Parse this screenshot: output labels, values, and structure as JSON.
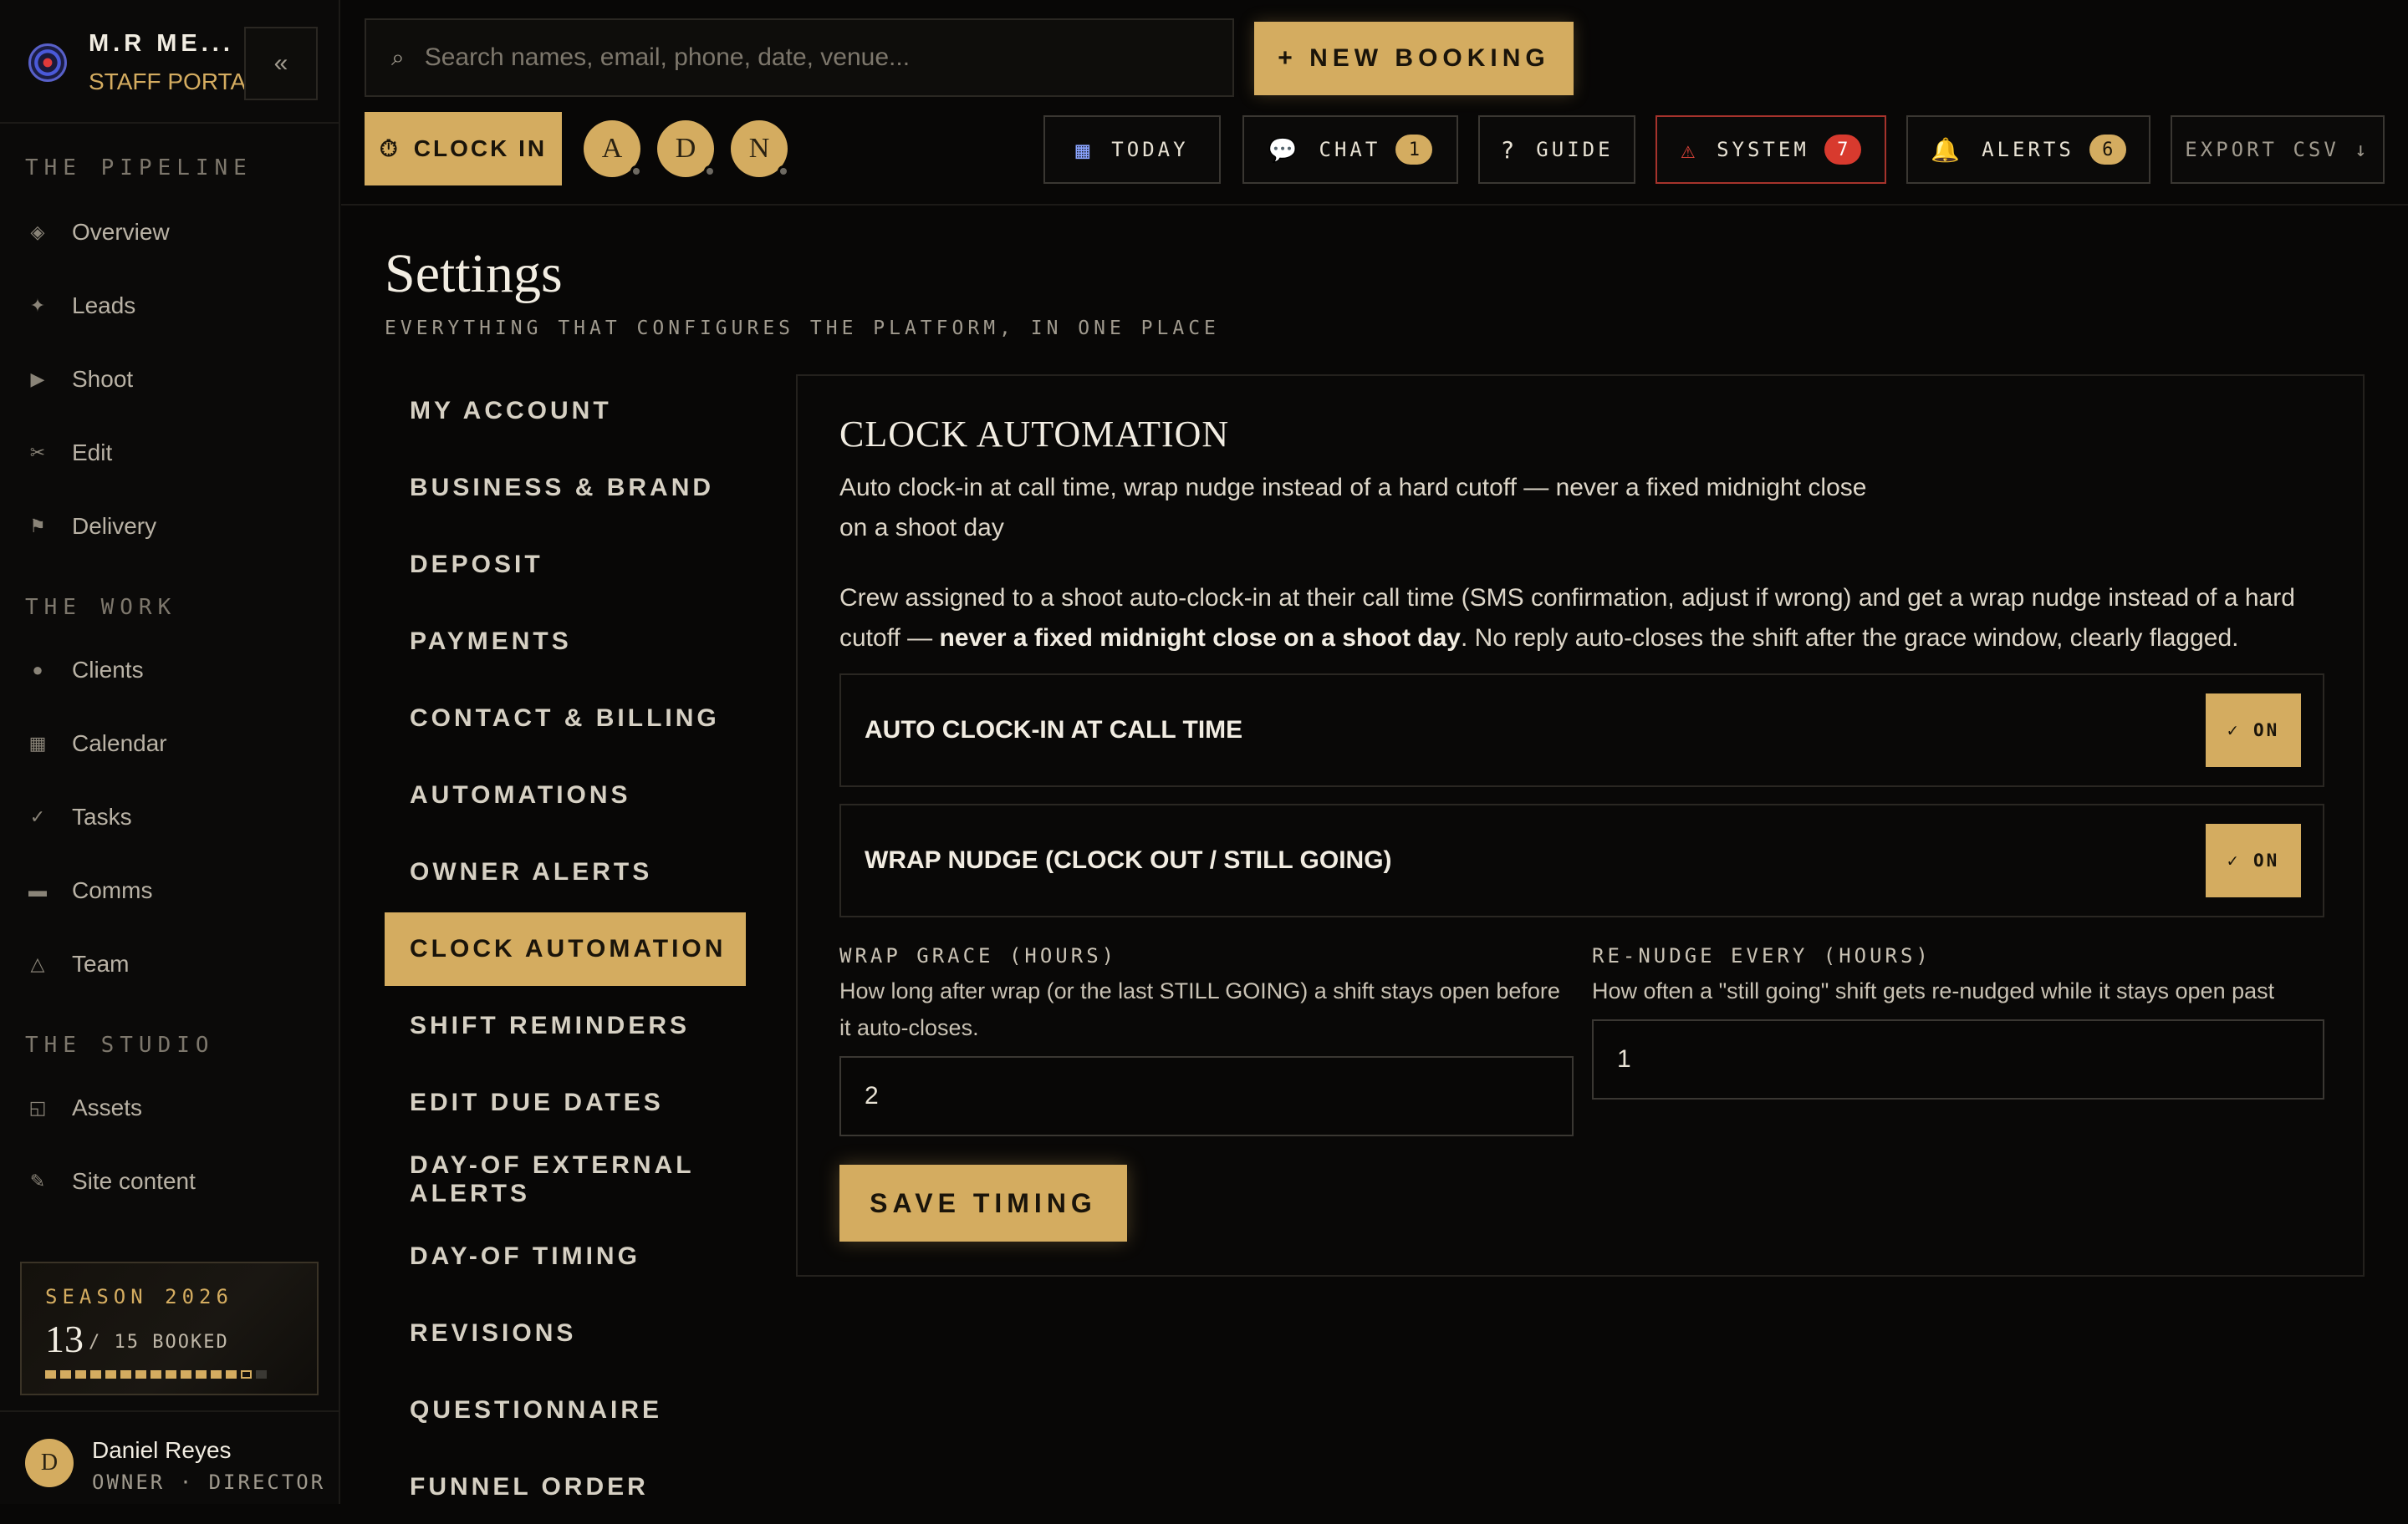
{
  "brand": {
    "name": "M.R ME...",
    "subtitle": "STAFF PORTAL",
    "collapse_glyph": "«"
  },
  "sidebar": {
    "sections": [
      {
        "title": "THE PIPELINE",
        "items": [
          {
            "label": "Overview",
            "icon": "diamond-icon",
            "glyph": "◈"
          },
          {
            "label": "Leads",
            "icon": "sparkle-icon",
            "glyph": "✦"
          },
          {
            "label": "Shoot",
            "icon": "play-icon",
            "glyph": "▶"
          },
          {
            "label": "Edit",
            "icon": "scissors-icon",
            "glyph": "✂"
          },
          {
            "label": "Delivery",
            "icon": "flag-icon",
            "glyph": "⚑"
          }
        ]
      },
      {
        "title": "THE WORK",
        "items": [
          {
            "label": "Clients",
            "icon": "dot-icon",
            "glyph": "●"
          },
          {
            "label": "Calendar",
            "icon": "grid-icon",
            "glyph": "▦"
          },
          {
            "label": "Tasks",
            "icon": "check-icon",
            "glyph": "✓"
          },
          {
            "label": "Comms",
            "icon": "dash-icon",
            "glyph": "▬"
          },
          {
            "label": "Team",
            "icon": "triangle-icon",
            "glyph": "△"
          }
        ]
      },
      {
        "title": "THE STUDIO",
        "items": [
          {
            "label": "Assets",
            "icon": "frame-icon",
            "glyph": "◱"
          },
          {
            "label": "Site content",
            "icon": "pencil-icon",
            "glyph": "✎"
          }
        ]
      }
    ],
    "season": {
      "title": "SEASON 2026",
      "booked": "13",
      "of_label": "/ 15 BOOKED",
      "booked_count": 13,
      "pending_count": 1,
      "total": 15
    },
    "user": {
      "initial": "D",
      "name": "Daniel Reyes",
      "role": "OWNER · DIRECTOR"
    }
  },
  "topbar": {
    "search_placeholder": "Search names, email, phone, date, venue...",
    "new_booking": "+ NEW BOOKING",
    "clock_in": "CLOCK IN",
    "crew": [
      "A",
      "D",
      "N"
    ],
    "buttons": [
      {
        "key": "today",
        "label": "TODAY",
        "icon": "calendar-icon",
        "glyph": "▦"
      },
      {
        "key": "chat",
        "label": "CHAT",
        "icon": "chat-bubble-icon",
        "glyph": "💬",
        "badge": "1"
      },
      {
        "key": "guide",
        "label": "GUIDE",
        "icon": "question-icon",
        "glyph": "?"
      },
      {
        "key": "system",
        "label": "SYSTEM",
        "icon": "warning-icon",
        "glyph": "⚠",
        "badge": "7"
      },
      {
        "key": "alerts",
        "label": "ALERTS",
        "icon": "bell-icon",
        "glyph": "🔔",
        "badge": "6"
      },
      {
        "key": "export",
        "label": "EXPORT CSV ↓"
      }
    ]
  },
  "page": {
    "title": "Settings",
    "subtitle": "EVERYTHING THAT CONFIGURES THE PLATFORM, IN ONE PLACE"
  },
  "settings_nav": [
    "MY ACCOUNT",
    "BUSINESS & BRAND",
    "DEPOSIT",
    "PAYMENTS",
    "CONTACT & BILLING",
    "AUTOMATIONS",
    "OWNER ALERTS",
    "CLOCK AUTOMATION",
    "SHIFT REMINDERS",
    "EDIT DUE DATES",
    "DAY-OF EXTERNAL ALERTS",
    "DAY-OF TIMING",
    "REVISIONS",
    "QUESTIONNAIRE",
    "FUNNEL ORDER"
  ],
  "settings_active": "CLOCK AUTOMATION",
  "panel": {
    "title": "CLOCK AUTOMATION",
    "lead": "Auto clock-in at call time, wrap nudge instead of a hard cutoff — never a fixed midnight close on a shoot day",
    "desc_before": "Crew assigned to a shoot auto-clock-in at their call time (SMS confirmation, adjust if wrong) and get a wrap nudge instead of a hard cutoff — ",
    "desc_bold": "never a fixed midnight close on a shoot day",
    "desc_after": ". No reply auto-closes the shift after the grace window, clearly flagged.",
    "toggles": [
      {
        "label": "AUTO CLOCK-IN AT CALL TIME",
        "state": "✓ ON"
      },
      {
        "label": "WRAP NUDGE (CLOCK OUT / STILL GOING)",
        "state": "✓ ON"
      }
    ],
    "wrap_grace": {
      "label": "WRAP GRACE (HOURS)",
      "help": "How long after wrap (or the last STILL GOING) a shift stays open before it auto-closes.",
      "value": "2"
    },
    "renudge": {
      "label": "RE-NUDGE EVERY (HOURS)",
      "help": "How often a \"still going\" shift gets re-nudged while it stays open past wrap.",
      "value": "1"
    },
    "save": "SAVE TIMING"
  },
  "colors": {
    "accent": "#d4ac60",
    "background": "#080706",
    "danger": "#d83a2e"
  }
}
